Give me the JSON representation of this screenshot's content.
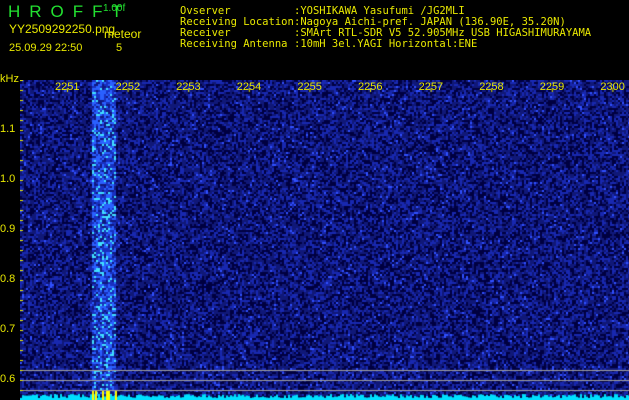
{
  "header": {
    "app_title": "HROFFT",
    "version": "1.00f",
    "filename": "YY2509292250.png",
    "datetime": "25.09.29 22:50",
    "meteor_label": "meteor",
    "meteor_count": "5",
    "info": [
      {
        "label": "Ovserver",
        "value": ":YOSHIKAWA Yasufumi /JG2MLI"
      },
      {
        "label": "Receiving Location",
        "value": ":Nagoya Aichi-pref. JAPAN (136.90E, 35.20N)"
      },
      {
        "label": "Receiver",
        "value": ":SMArt RTL-SDR V5 52.905MHz USB HIGASHIMURAYAMA"
      },
      {
        "label": "Receiving Antenna",
        "value": ":10mH 3el.YAGI Horizontal:ENE"
      }
    ]
  },
  "spectrogram": {
    "y_unit": "kHz",
    "y_ticks": [
      "1.1",
      "1.0",
      "0.9",
      "0.8",
      "0.7",
      "0.6"
    ],
    "time_labels": [
      "2251",
      "2252",
      "2253",
      "2254",
      "2255",
      "2256",
      "2257",
      "2258",
      "2259",
      "2300"
    ],
    "meteor_minute": "2251-2252",
    "colors": {
      "bg": "#00006a",
      "meteor": "#2a60ff",
      "baseline": "#00e0ff",
      "marker": "#ffff00",
      "grid": "#a0a0a0"
    }
  }
}
